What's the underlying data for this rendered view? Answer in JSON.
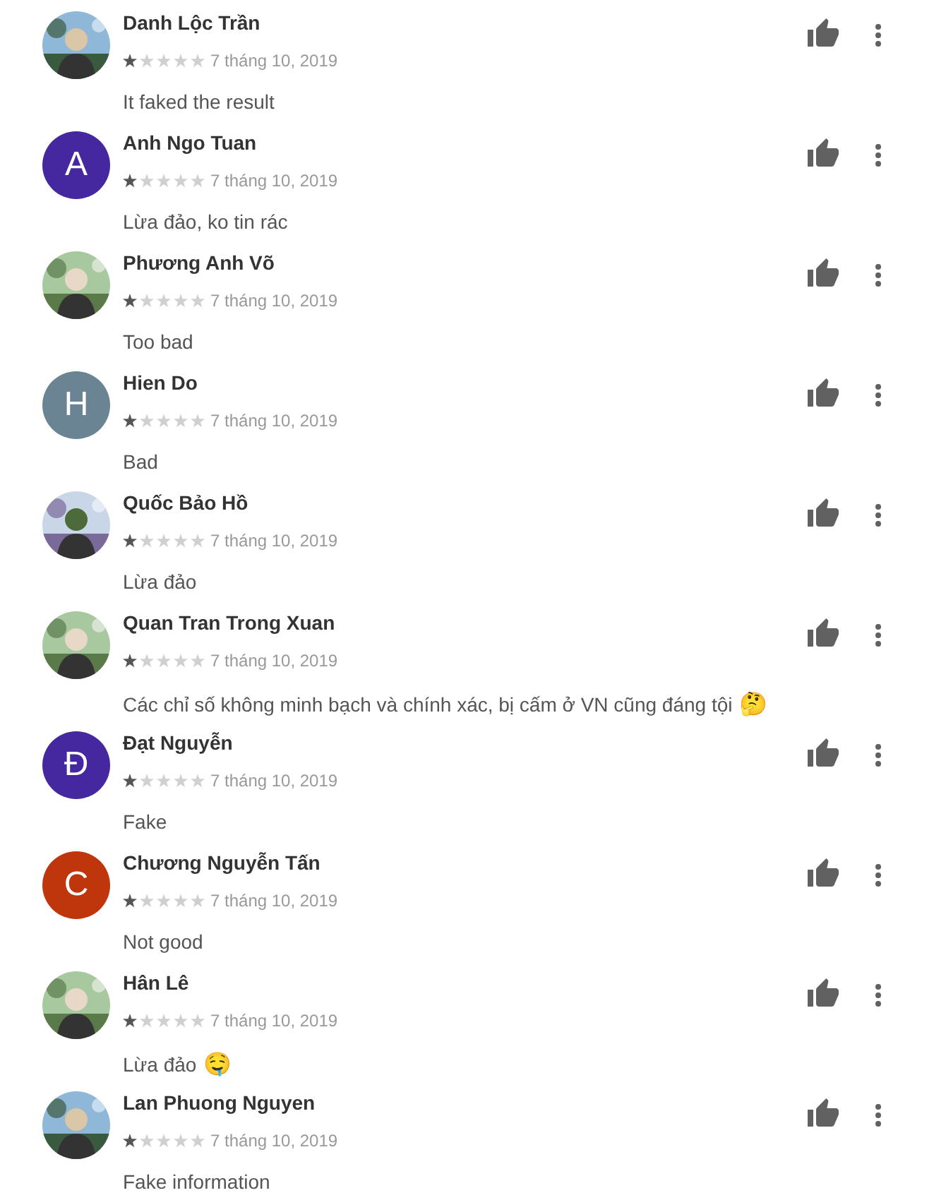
{
  "reviews": [
    {
      "author": "Danh Lộc Trần",
      "stars": 1,
      "date": "7 tháng 10, 2019",
      "text": "It faked the result"
    },
    {
      "author": "Anh Ngo Tuan",
      "avatar": {
        "kind": "letter",
        "letter": "A",
        "color": "#4527a0"
      },
      "stars": 1,
      "date": "7 tháng 10, 2019",
      "text": "Lừa đảo, ko tin rác"
    },
    {
      "author": "Phương Anh Võ",
      "stars": 1,
      "date": "7 tháng 10, 2019",
      "text": "Too bad"
    },
    {
      "author": "Hien Do",
      "avatar": {
        "kind": "letter",
        "letter": "H",
        "color": "#6a8493"
      },
      "stars": 1,
      "date": "7 tháng 10, 2019",
      "text": "Bad"
    },
    {
      "author": "Quốc Bảo Hồ",
      "stars": 1,
      "date": "7 tháng 10, 2019",
      "text": "Lừa đảo"
    },
    {
      "author": "Quan Tran Trong Xuan",
      "stars": 1,
      "date": "7 tháng 10, 2019",
      "text": "Các chỉ số không minh bạch và chính xác, bị cấm ở VN cũng đáng tội",
      "emoji": "🤔"
    },
    {
      "author": "Đạt Nguyễn",
      "avatar": {
        "kind": "letter",
        "letter": "Đ",
        "color": "#4527a0"
      },
      "stars": 1,
      "date": "7 tháng 10, 2019",
      "text": "Fake"
    },
    {
      "author": "Chương Nguyễn Tấn",
      "avatar": {
        "kind": "letter",
        "letter": "C",
        "color": "#bf360c"
      },
      "stars": 1,
      "date": "7 tháng 10, 2019",
      "text": "Not good"
    },
    {
      "author": "Hân Lê",
      "stars": 1,
      "date": "7 tháng 10, 2019",
      "text": "Lừa đảo",
      "emoji": "🤤"
    },
    {
      "author": "Lan Phuong Nguyen",
      "stars": 1,
      "date": "7 tháng 10, 2019",
      "text": "Fake information"
    }
  ]
}
